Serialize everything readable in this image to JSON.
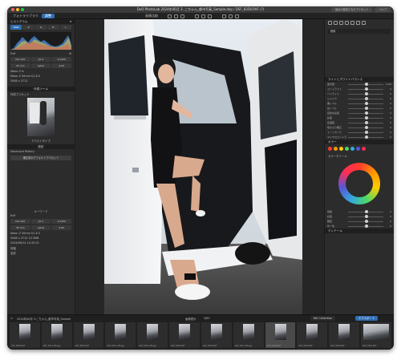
{
  "window": {
    "title": "DxO PhotoLab 2024年06月 3. こちゃん_都市写真_Sample.dop / DSF_8358.RAF (?)",
    "traffic_colors": [
      "#ff5f57",
      "#febc2e",
      "#28c840"
    ],
    "right_buttons": [
      "最近の使用されたプリセット",
      "ヘルプ"
    ]
  },
  "tabs": [
    {
      "label": "フォトライブラリ",
      "active": false
    },
    {
      "label": "調整",
      "active": true
    }
  ],
  "toolbar": {
    "zoom_label": "画像比較"
  },
  "left_panel": {
    "histogram_title": "ヒストグラム",
    "histogram_tools": [
      "RGB",
      "R",
      "G",
      "B",
      "L"
    ],
    "exif_label": "Exif",
    "exif_values": [
      "ISO 100",
      "ƒ/1.2",
      "1/1250",
      "35 mm",
      "Sybel",
      "4:00"
    ],
    "camera": "Nikon Z 50mm f/1.8 S",
    "camera_short": "Nikon Z fc",
    "size_label": "5568 x 3712",
    "rating_label": "評価",
    "preset_title": "作成ツール",
    "preset_subtitle": "作成プリセット",
    "thumb_caption": "アラストタイプ",
    "advanced_title": "設定",
    "advanced_label": "Advanced History",
    "advanced_button": "補正前のデフォルトプリセット",
    "exif2_label": "Exif",
    "exif2_values": [
      "ISO 100",
      "ƒ/1.2",
      "1/1250",
      "35 mm",
      "Sybel",
      "4:00"
    ],
    "camera2": "Nikon Z 50mm f/1.8 S",
    "info_lines": [
      "5568 x 3712 14.3MB",
      "2024/06/14 14:33:01"
    ],
    "keyword_label": "キーワード",
    "rename_label": "名前"
  },
  "filmstrip_bar": {
    "folder_path": "2024年06月 3.こちゃん_都市写真_Sample",
    "center_label_1": "画像表示",
    "center_label_2": "5/82",
    "tab1": "Nik Collection",
    "tab2": "エクスポート"
  },
  "filmstrip": [
    {
      "name": "DSF_8350.RAF",
      "active": false
    },
    {
      "name": "DSF_8351_MK.jpg",
      "active": false
    },
    {
      "name": "DSF_8352.RAF",
      "active": false
    },
    {
      "name": "DSF_8353_MK.jpg",
      "active": false
    },
    {
      "name": "DSF_8354_MK.jpg",
      "active": false
    },
    {
      "name": "DSF_8355.RAF",
      "active": false
    },
    {
      "name": "DSF_8356.RAF",
      "active": false
    },
    {
      "name": "DSF_8357_MK.jpg",
      "active": false
    },
    {
      "name": "DSF_8358.RAF",
      "active": true
    },
    {
      "name": "DSF_8359.RAF",
      "active": false
    },
    {
      "name": "DSF_8360.RAF",
      "active": false
    },
    {
      "name": "DSF_8361.RAF",
      "active": false
    }
  ],
  "right_panel": {
    "search_placeholder": "検索",
    "section_light": "ライトとホワイトバランス",
    "section_color": "カラー",
    "section_detail": "ディテール",
    "sliders": [
      {
        "label": "露光量",
        "value": "0.00"
      },
      {
        "label": "コントラスト",
        "value": "0"
      },
      {
        "label": "ハイライト",
        "value": "0"
      },
      {
        "label": "シャドウ",
        "value": "0"
      },
      {
        "label": "黒レベル",
        "value": "0"
      },
      {
        "label": "白レベル",
        "value": "0"
      },
      {
        "label": "自然な彩度",
        "value": "0"
      },
      {
        "label": "彩度",
        "value": "0"
      },
      {
        "label": "色温度",
        "value": "0"
      },
      {
        "label": "色かぶり補正",
        "value": "0"
      },
      {
        "label": "トーンカーブ",
        "value": "0"
      },
      {
        "label": "マイクロコントラスト",
        "value": "0"
      }
    ],
    "wheel_label": "カラーホイール",
    "wheel_sliders": [
      {
        "label": "色相",
        "value": "0"
      },
      {
        "label": "彩度",
        "value": "0"
      },
      {
        "label": "輝度",
        "value": "0"
      },
      {
        "label": "均一性",
        "value": "0"
      }
    ],
    "colors": [
      "#ff3b30",
      "#ff9500",
      "#ffcc00",
      "#4cd964",
      "#34aadc",
      "#5856d6",
      "#ff2d55"
    ]
  }
}
